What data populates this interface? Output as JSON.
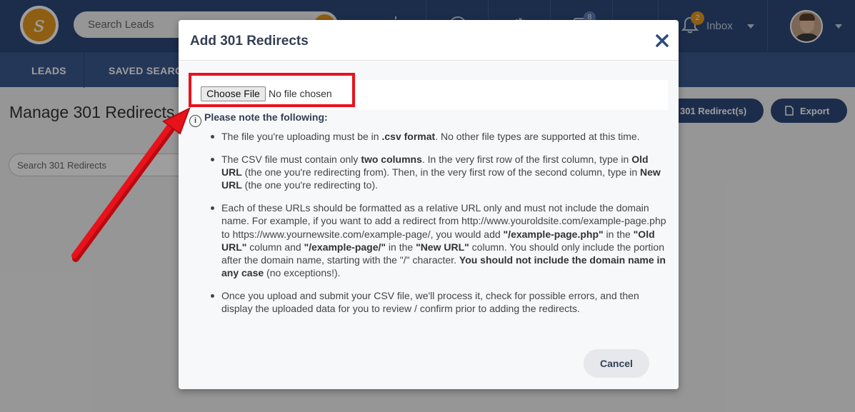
{
  "topbar": {
    "search_placeholder": "Search Leads",
    "message_badge": "8",
    "notification_badge": "2",
    "inbox_label": "Inbox"
  },
  "nav": {
    "leads": "LEADS",
    "saved_searches": "SAVED SEARCH"
  },
  "page": {
    "title": "Manage 301 Redirects",
    "search_placeholder": "Search 301 Redirects",
    "add_button": "301 Redirect(s)",
    "export_button": "Export"
  },
  "modal": {
    "title": "Add 301 Redirects",
    "choose_file": "Choose File",
    "no_file": "No file chosen",
    "note_heading": "Please note the following:",
    "info_glyph": "i",
    "cancel": "Cancel",
    "items": [
      {
        "a": "The file you're uploading must be in ",
        "b": ".csv format",
        "c": ". No other file types are supported at this time."
      },
      {
        "a": "The CSV file must contain only ",
        "b": "two columns",
        "c": ". In the very first row of the first column, type in ",
        "d": "Old URL",
        "e": " (the one you're redirecting from). Then, in the very first row of the second column, type in ",
        "f": "New URL",
        "g": " (the one you're redirecting to)."
      },
      {
        "a": "Each of these URLs should be formatted as a relative URL only and must not include the domain name. For example, if you want to add a redirect from http://www.youroldsite.com/example-page.php to https://www.yournewsite.com/example-page/, you would add ",
        "b": "\"/example-page.php\"",
        "c": " in the ",
        "d": "\"Old URL\"",
        "e": " column and ",
        "f": "\"/example-page/\"",
        "g": " in the ",
        "h": "\"New URL\"",
        "i": " column. You should only include the portion after the domain name, starting with the \"/\" character. ",
        "j": "You should not include the domain name in any case",
        "k": " (no exceptions!)."
      },
      {
        "a": "Once you upload and submit your CSV file, we'll process it, check for possible errors, and then display the uploaded data for you to review / confirm prior to adding the redirects."
      }
    ]
  },
  "colors": {
    "header_bg": "#2e4a7b",
    "nav_bg": "#3a5a8f",
    "accent_orange": "#e59a1e",
    "highlight_red": "#e8121b"
  }
}
